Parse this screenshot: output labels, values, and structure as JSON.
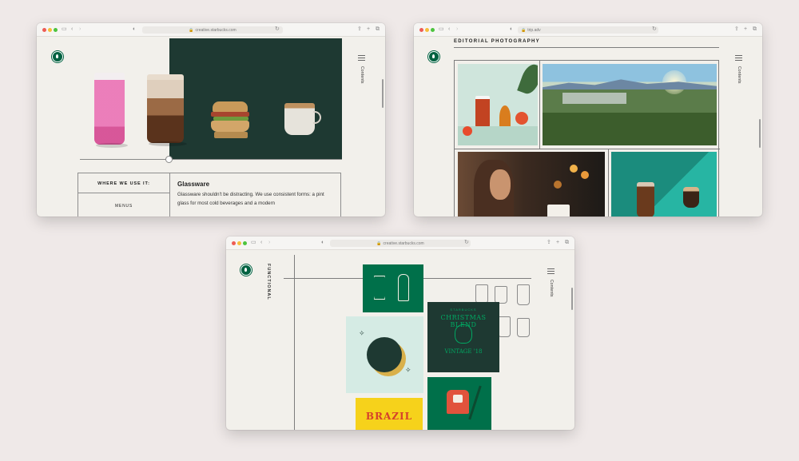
{
  "windows": [
    {
      "url": "creative.starbucks.com",
      "contents_label": "Contents",
      "where_heading": "WHERE WE USE IT:",
      "menus_label": "MENUS",
      "section_title": "Glassware",
      "section_body": "Glassware shouldn't be distracting. We use consistent forms: a pint glass for most cold beverages and a modern",
      "slider_position": 0.34
    },
    {
      "url": "trip.adv",
      "contents_label": "Contents",
      "heading": "EDITORIAL PHOTOGRAPHY"
    },
    {
      "url": "creative.starbucks.com",
      "contents_label": "Contents",
      "section_label": "FUNCTIONAL",
      "christmas_top": "STARBUCKS",
      "christmas_title": "CHRISTMAS BLEND",
      "christmas_vintage": "VINTAGE '18",
      "brazil_text": "BRAZIL"
    }
  ],
  "colors": {
    "starbucks_green": "#006241",
    "house_green": "#1e3932",
    "page_bg": "#efe9e8",
    "window_bg": "#f2f0eb"
  },
  "icons": [
    "starbucks-logo-icon",
    "menu-icon",
    "sidebar-icon",
    "back-icon",
    "forward-icon",
    "share-icon",
    "new-tab-icon",
    "tabs-icon",
    "reload-icon",
    "lock-icon"
  ]
}
